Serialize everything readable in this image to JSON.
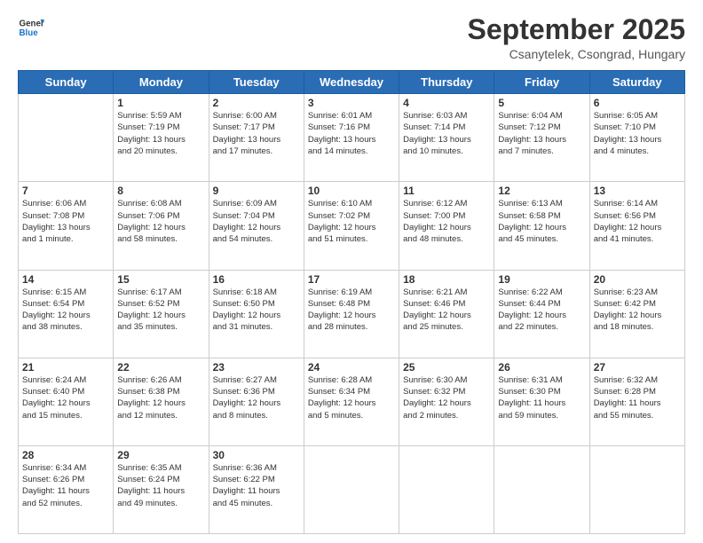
{
  "logo": {
    "line1": "General",
    "line2": "Blue"
  },
  "header": {
    "title": "September 2025",
    "subtitle": "Csanytelek, Csongrad, Hungary"
  },
  "days_of_week": [
    "Sunday",
    "Monday",
    "Tuesday",
    "Wednesday",
    "Thursday",
    "Friday",
    "Saturday"
  ],
  "weeks": [
    [
      {
        "day": "",
        "info": ""
      },
      {
        "day": "1",
        "info": "Sunrise: 5:59 AM\nSunset: 7:19 PM\nDaylight: 13 hours\nand 20 minutes."
      },
      {
        "day": "2",
        "info": "Sunrise: 6:00 AM\nSunset: 7:17 PM\nDaylight: 13 hours\nand 17 minutes."
      },
      {
        "day": "3",
        "info": "Sunrise: 6:01 AM\nSunset: 7:16 PM\nDaylight: 13 hours\nand 14 minutes."
      },
      {
        "day": "4",
        "info": "Sunrise: 6:03 AM\nSunset: 7:14 PM\nDaylight: 13 hours\nand 10 minutes."
      },
      {
        "day": "5",
        "info": "Sunrise: 6:04 AM\nSunset: 7:12 PM\nDaylight: 13 hours\nand 7 minutes."
      },
      {
        "day": "6",
        "info": "Sunrise: 6:05 AM\nSunset: 7:10 PM\nDaylight: 13 hours\nand 4 minutes."
      }
    ],
    [
      {
        "day": "7",
        "info": "Sunrise: 6:06 AM\nSunset: 7:08 PM\nDaylight: 13 hours\nand 1 minute."
      },
      {
        "day": "8",
        "info": "Sunrise: 6:08 AM\nSunset: 7:06 PM\nDaylight: 12 hours\nand 58 minutes."
      },
      {
        "day": "9",
        "info": "Sunrise: 6:09 AM\nSunset: 7:04 PM\nDaylight: 12 hours\nand 54 minutes."
      },
      {
        "day": "10",
        "info": "Sunrise: 6:10 AM\nSunset: 7:02 PM\nDaylight: 12 hours\nand 51 minutes."
      },
      {
        "day": "11",
        "info": "Sunrise: 6:12 AM\nSunset: 7:00 PM\nDaylight: 12 hours\nand 48 minutes."
      },
      {
        "day": "12",
        "info": "Sunrise: 6:13 AM\nSunset: 6:58 PM\nDaylight: 12 hours\nand 45 minutes."
      },
      {
        "day": "13",
        "info": "Sunrise: 6:14 AM\nSunset: 6:56 PM\nDaylight: 12 hours\nand 41 minutes."
      }
    ],
    [
      {
        "day": "14",
        "info": "Sunrise: 6:15 AM\nSunset: 6:54 PM\nDaylight: 12 hours\nand 38 minutes."
      },
      {
        "day": "15",
        "info": "Sunrise: 6:17 AM\nSunset: 6:52 PM\nDaylight: 12 hours\nand 35 minutes."
      },
      {
        "day": "16",
        "info": "Sunrise: 6:18 AM\nSunset: 6:50 PM\nDaylight: 12 hours\nand 31 minutes."
      },
      {
        "day": "17",
        "info": "Sunrise: 6:19 AM\nSunset: 6:48 PM\nDaylight: 12 hours\nand 28 minutes."
      },
      {
        "day": "18",
        "info": "Sunrise: 6:21 AM\nSunset: 6:46 PM\nDaylight: 12 hours\nand 25 minutes."
      },
      {
        "day": "19",
        "info": "Sunrise: 6:22 AM\nSunset: 6:44 PM\nDaylight: 12 hours\nand 22 minutes."
      },
      {
        "day": "20",
        "info": "Sunrise: 6:23 AM\nSunset: 6:42 PM\nDaylight: 12 hours\nand 18 minutes."
      }
    ],
    [
      {
        "day": "21",
        "info": "Sunrise: 6:24 AM\nSunset: 6:40 PM\nDaylight: 12 hours\nand 15 minutes."
      },
      {
        "day": "22",
        "info": "Sunrise: 6:26 AM\nSunset: 6:38 PM\nDaylight: 12 hours\nand 12 minutes."
      },
      {
        "day": "23",
        "info": "Sunrise: 6:27 AM\nSunset: 6:36 PM\nDaylight: 12 hours\nand 8 minutes."
      },
      {
        "day": "24",
        "info": "Sunrise: 6:28 AM\nSunset: 6:34 PM\nDaylight: 12 hours\nand 5 minutes."
      },
      {
        "day": "25",
        "info": "Sunrise: 6:30 AM\nSunset: 6:32 PM\nDaylight: 12 hours\nand 2 minutes."
      },
      {
        "day": "26",
        "info": "Sunrise: 6:31 AM\nSunset: 6:30 PM\nDaylight: 11 hours\nand 59 minutes."
      },
      {
        "day": "27",
        "info": "Sunrise: 6:32 AM\nSunset: 6:28 PM\nDaylight: 11 hours\nand 55 minutes."
      }
    ],
    [
      {
        "day": "28",
        "info": "Sunrise: 6:34 AM\nSunset: 6:26 PM\nDaylight: 11 hours\nand 52 minutes."
      },
      {
        "day": "29",
        "info": "Sunrise: 6:35 AM\nSunset: 6:24 PM\nDaylight: 11 hours\nand 49 minutes."
      },
      {
        "day": "30",
        "info": "Sunrise: 6:36 AM\nSunset: 6:22 PM\nDaylight: 11 hours\nand 45 minutes."
      },
      {
        "day": "",
        "info": ""
      },
      {
        "day": "",
        "info": ""
      },
      {
        "day": "",
        "info": ""
      },
      {
        "day": "",
        "info": ""
      }
    ]
  ]
}
